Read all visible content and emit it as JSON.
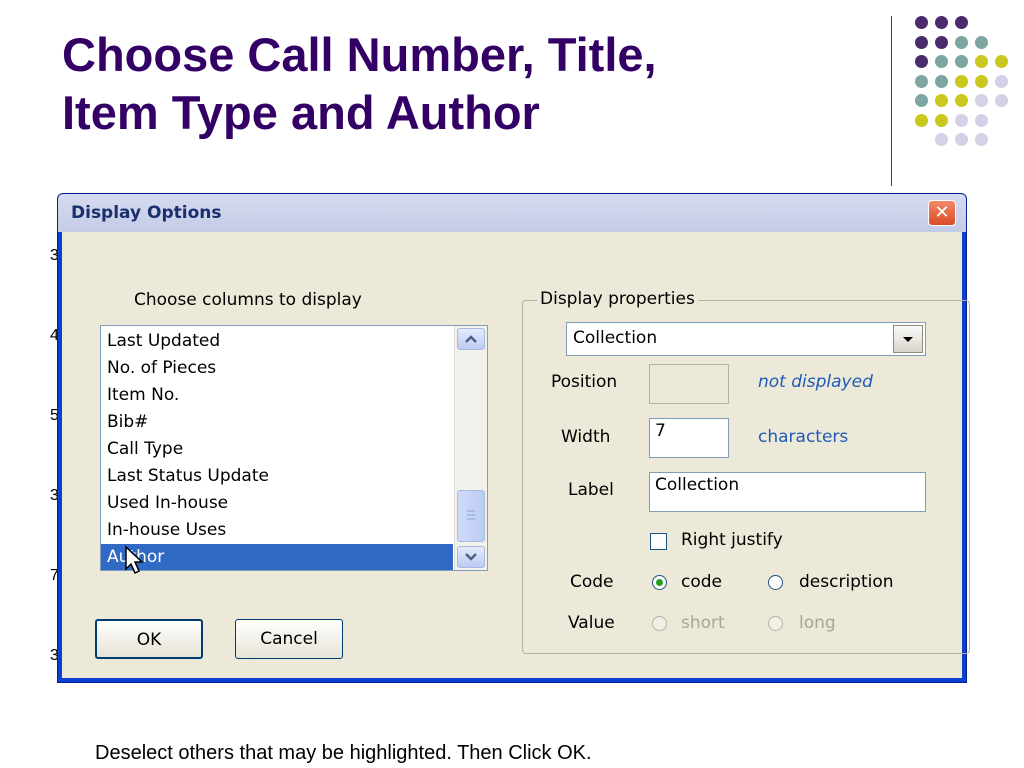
{
  "slide": {
    "title_line1": "Choose Call Number, Title,",
    "title_line2": "Item Type and Author",
    "footer_note": "Deselect others that may be highlighted. Then Click OK.",
    "accent_colors": {
      "purple": "#4b2a6e",
      "teal": "#7da5a2",
      "yellow": "#c8c81e",
      "lavender": "#d3d0e8"
    }
  },
  "dialog": {
    "title": "Display Options",
    "close_icon": "close-x-icon",
    "columns_heading": "Choose columns to display",
    "columns": [
      {
        "label": "Last Updated",
        "selected": false
      },
      {
        "label": "No. of Pieces",
        "selected": false
      },
      {
        "label": "Item No.",
        "selected": false
      },
      {
        "label": "Bib#",
        "selected": false
      },
      {
        "label": "Call Type",
        "selected": false
      },
      {
        "label": "Last Status Update",
        "selected": false
      },
      {
        "label": "Used In-house",
        "selected": false
      },
      {
        "label": "In-house Uses",
        "selected": false
      },
      {
        "label": "Author",
        "selected": true
      }
    ],
    "properties": {
      "legend": "Display properties",
      "selected_column": "Collection",
      "position_label": "Position",
      "position_value": "",
      "position_hint": "not displayed",
      "width_label": "Width",
      "width_value": "7",
      "width_unit": "characters",
      "label_label": "Label",
      "label_value": "Collection",
      "right_justify_label": "Right justify",
      "right_justify_checked": false,
      "code_label": "Code",
      "code_options": [
        "code",
        "description"
      ],
      "code_selected": "code",
      "value_label": "Value",
      "value_options": [
        "short",
        "long"
      ]
    },
    "ok_label": "OK",
    "cancel_label": "Cancel"
  }
}
